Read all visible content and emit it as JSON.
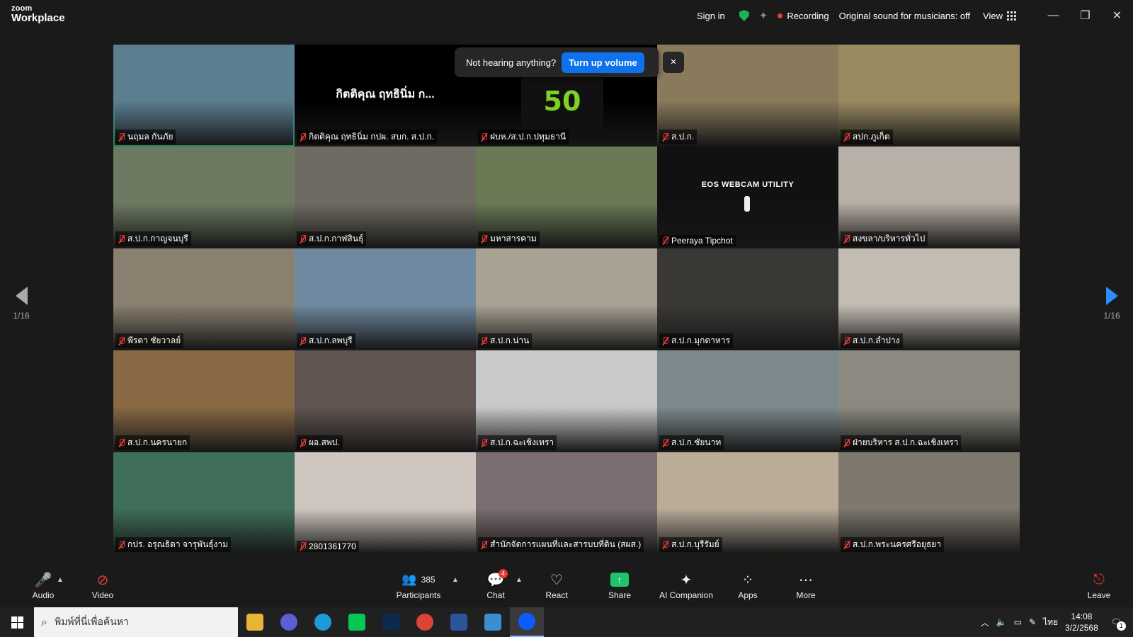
{
  "titlebar": {
    "logo_line1": "zoom",
    "logo_line2": "Workplace",
    "sign_in": "Sign in",
    "recording": "Recording",
    "sound": "Original sound for musicians: off",
    "view": "View"
  },
  "banner": {
    "text": "Not hearing anything?",
    "button": "Turn up volume",
    "close": "×"
  },
  "pagination": {
    "left": "1/16",
    "right": "1/16"
  },
  "tiles": [
    {
      "name": "นฤมล กันภัย",
      "bg": "#5c7f90"
    },
    {
      "name": "กิตติคุณ ฤทธินิ่ม กปผ. สบก. ส.ป.ก.",
      "bg": "#000000",
      "big": "กิตติคุณ ฤทธินิ่ม ก..."
    },
    {
      "name": "ฝบห./ส.ป.ก.ปทุมธานี",
      "bg": "#000000",
      "logo": "50"
    },
    {
      "name": "ส.ป.ก.",
      "bg": "#8a7a5c"
    },
    {
      "name": "สปก.ภูเก็ต",
      "bg": "#9a8a60"
    },
    {
      "name": "ส.ป.ก.กาญจนบุรี",
      "bg": "#6d7a62"
    },
    {
      "name": "ส.ป.ก.กาฬสินธุ์",
      "bg": "#6e6c62"
    },
    {
      "name": "มหาสารคาม",
      "bg": "#6a7a55"
    },
    {
      "name": "Peeraya Tipchot",
      "bg": "#111111",
      "eos": "EOS WEBCAM UTILITY"
    },
    {
      "name": "สงขลา/บริหารทั่วไป",
      "bg": "#b8b0a6"
    },
    {
      "name": "พีรดา ชัยวาลย์",
      "bg": "#8a8070"
    },
    {
      "name": "ส.ป.ก.ลพบุรี",
      "bg": "#6f8aa0"
    },
    {
      "name": "ส.ป.ก.น่าน",
      "bg": "#a9a293"
    },
    {
      "name": "ส.ป.ก.มุกดาหาร",
      "bg": "#3a3835"
    },
    {
      "name": "ส.ป.ก.ลำปาง",
      "bg": "#c2bcb3"
    },
    {
      "name": "ส.ป.ก.นครนายก",
      "bg": "#8a6a45"
    },
    {
      "name": "ผอ.สพป.",
      "bg": "#605550"
    },
    {
      "name": "ส.ป.ก.ฉะเชิงเทรา",
      "bg": "#c8cac9"
    },
    {
      "name": "ส.ป.ก.ชัยนาท",
      "bg": "#7d8a8d"
    },
    {
      "name": "ฝ่ายบริหาร ส.ป.ก.ฉะเชิงเทรา",
      "bg": "#8c8a80"
    },
    {
      "name": "กปร. อรุณธิดา จารุพันธุ์งาม",
      "bg": "#3f6f5a"
    },
    {
      "name": "2801361770",
      "bg": "#cfc7bf"
    },
    {
      "name": "สำนักจัดการแผนที่และสารบบที่ดิน (สผส.)",
      "bg": "#7c6e70"
    },
    {
      "name": "ส.ป.ก.บุรีรัมย์",
      "bg": "#b9ad98"
    },
    {
      "name": "ส.ป.ก.พระนครศรีอยุธยา",
      "bg": "#7e786e"
    }
  ],
  "toolbar": {
    "audio": "Audio",
    "video": "Video",
    "participants": "Participants",
    "participants_count": "385",
    "chat": "Chat",
    "chat_badge": "4",
    "react": "React",
    "share": "Share",
    "ai": "AI Companion",
    "apps": "Apps",
    "more": "More",
    "leave": "Leave"
  },
  "taskbar": {
    "search_placeholder": "พิมพ์ที่นี่เพื่อค้นหา",
    "lang": "ไทย",
    "time": "14:08",
    "date": "3/2/2568",
    "notif": "1"
  }
}
